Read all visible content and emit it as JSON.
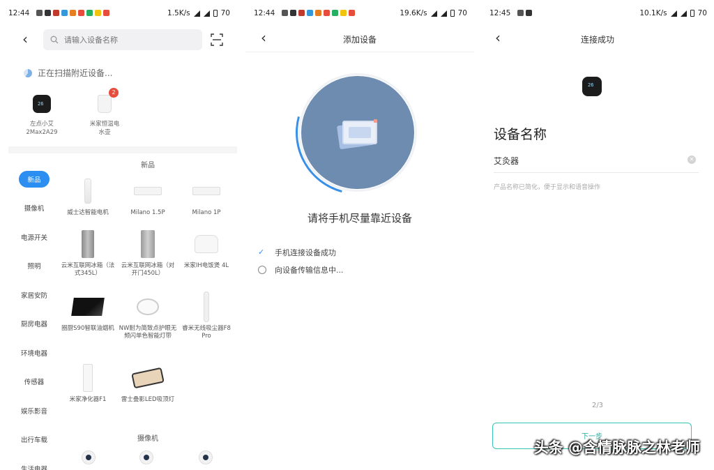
{
  "panels": [
    {
      "status": {
        "time": "12:44",
        "speed": "1.5K/s",
        "battery": "70"
      },
      "search": {
        "placeholder": "请输入设备名称"
      },
      "scanning": "正在扫描附近设备...",
      "nearby": [
        {
          "name": "左点小艾\n2Max2A29",
          "icon": "thermostat-icon"
        },
        {
          "name": "米家恒温电\n水壶",
          "icon": "kettle-icon",
          "badge": "2"
        }
      ],
      "categories": [
        "新品",
        "摄像机",
        "电源开关",
        "照明",
        "家居安防",
        "厨房电器",
        "环境电器",
        "传感器",
        "娱乐影音",
        "出行车载",
        "生活电器"
      ],
      "section_new": "新品",
      "section_camera": "摄像机",
      "products": [
        "威士达智能电机",
        "Milano 1.5P",
        "Milano 1P",
        "云米互联网冰箱（法式345L）",
        "云米互联网冰箱（对开门450L）",
        "米家IH电饭煲 4L",
        "圈厨S90智联油烟机",
        "NW耐为简致点护眼无频闪单色智能灯带",
        "睿米无线吸尘器F8 Pro",
        "米家净化器F1",
        "雷士叠影LED吸顶灯"
      ]
    },
    {
      "status": {
        "time": "12:44",
        "speed": "19.6K/s",
        "battery": "70"
      },
      "title": "添加设备",
      "instruction": "请将手机尽量靠近设备",
      "steps": [
        {
          "label": "手机连接设备成功",
          "done": true
        },
        {
          "label": "向设备传输信息中...",
          "done": false
        }
      ]
    },
    {
      "status": {
        "time": "12:45",
        "speed": "10.1K/s",
        "battery": "70"
      },
      "title": "连接成功",
      "heading": "设备名称",
      "name_value": "艾灸器",
      "hint": "产品名称已简化，便于显示和语音操作",
      "page_indicator": "2/3",
      "next_label": "下一步"
    }
  ],
  "watermark": "头条 @含情脉脉之林老师",
  "colors": {
    "accent": "#2b8ef0",
    "teal": "#38c5b8",
    "circle": "#6e8bb0",
    "badge": "#e74c3c"
  }
}
